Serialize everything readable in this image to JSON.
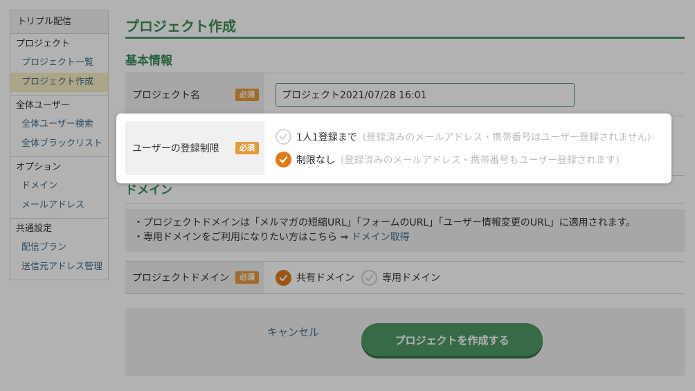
{
  "sidebar": {
    "header": "トリプル配信",
    "groups": [
      {
        "title": "プロジェクト",
        "items": [
          "プロジェクト一覧",
          "プロジェクト作成"
        ]
      },
      {
        "title": "全体ユーザー",
        "items": [
          "全体ユーザー検索",
          "全体ブラックリスト"
        ]
      },
      {
        "title": "オプション",
        "items": [
          "ドメイン",
          "メールアドレス"
        ]
      },
      {
        "title": "共通設定",
        "items": [
          "配信プラン",
          "送信元アドレス管理"
        ]
      }
    ],
    "active_item": "プロジェクト作成"
  },
  "main": {
    "page_title": "プロジェクト作成",
    "basic_section_title": "基本情報",
    "required_badge": "必須",
    "project_name": {
      "label": "プロジェクト名",
      "value": "プロジェクト2021/07/28 16:01"
    },
    "registration_limit": {
      "label": "ユーザーの登録制限",
      "options": [
        {
          "label": "1人1登録まで",
          "note": "(登録済みのメールアドレス・携帯番号はユーザー登録されません)",
          "checked": false
        },
        {
          "label": "制限なし",
          "note": "(登録済みのメールアドレス・携帯番号もユーザー登録されます)",
          "checked": true
        }
      ]
    },
    "domain_section_title": "ドメイン",
    "domain_info": {
      "line1": "・プロジェクトドメインは「メルマガの短縮URL」「フォームのURL」「ユーザー情報変更のURL」に適用されます。",
      "line2_prefix": "・専用ドメインをご利用になりたい方はこちら ⇒ ",
      "line2_link": "ドメイン取得"
    },
    "project_domain": {
      "label": "プロジェクトドメイン",
      "options": [
        {
          "label": "共有ドメイン",
          "checked": true
        },
        {
          "label": "専用ドメイン",
          "checked": false
        }
      ]
    },
    "cancel_label": "キャンセル",
    "create_label": "プロジェクトを作成する"
  },
  "colors": {
    "accent_green": "#4a9a63",
    "link_blue": "#3f6e8e",
    "required_orange": "#e79a3c",
    "radio_orange": "#e07b1a",
    "active_highlight": "#f6ecc3"
  }
}
